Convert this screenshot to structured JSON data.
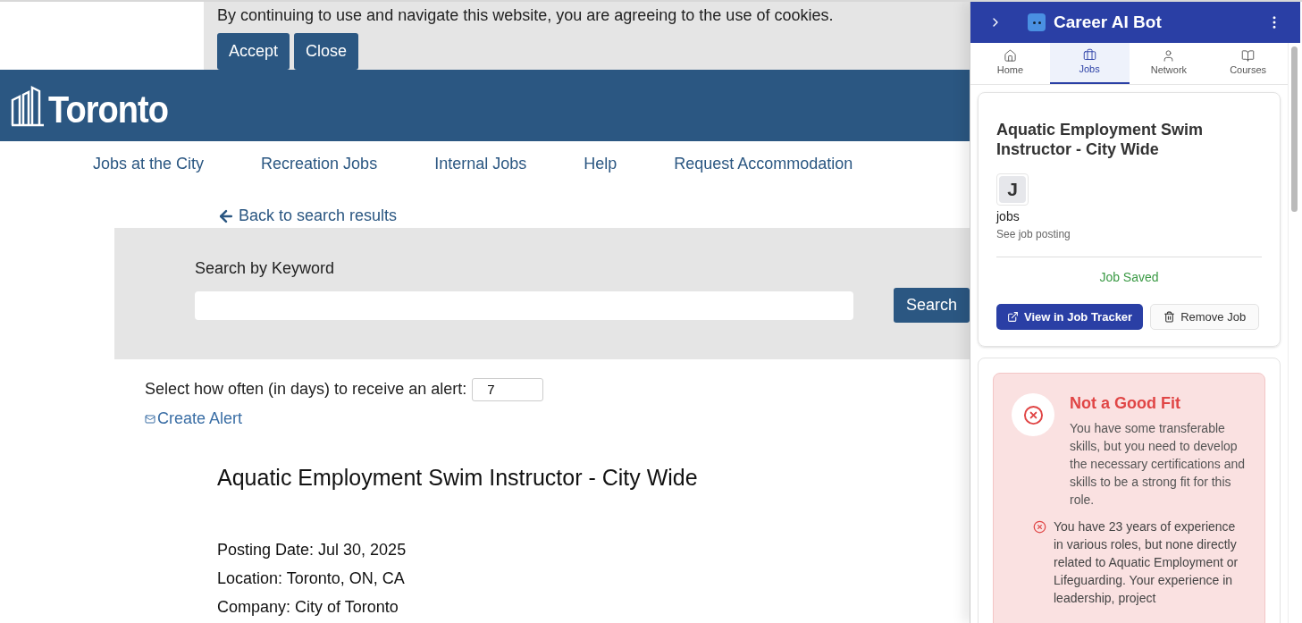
{
  "cookie_banner": {
    "message": "By continuing to use and navigate this website, you are agreeing to the use of cookies.",
    "buttons": [
      "Accept",
      "Close"
    ]
  },
  "header": {
    "logo": "Toronto"
  },
  "nav": [
    "Jobs at the City",
    "Recreation Jobs",
    "Internal Jobs",
    "Help",
    "Request Accommodation"
  ],
  "back_link": "Back to search results",
  "search": {
    "label": "Search by Keyword",
    "button": "Search"
  },
  "alert": {
    "label": "Select how often (in days) to receive an alert:",
    "value": "7",
    "link": "Create Alert"
  },
  "job": {
    "title": "Aquatic Employment Swim Instructor - City Wide",
    "details": [
      "Posting Date: Jul 30, 2025",
      "Location: Toronto, ON, CA",
      "Company: City of Toronto"
    ]
  },
  "panel": {
    "title": "Career AI Bot",
    "tabs": [
      {
        "label": "Home",
        "selected": false
      },
      {
        "label": "Jobs",
        "selected": true
      },
      {
        "label": "Network",
        "selected": false
      },
      {
        "label": "Courses",
        "selected": false
      }
    ],
    "job_card": {
      "title": "Aquatic Employment Swim Instructor - City Wide",
      "avatar": "J",
      "company": "jobs",
      "link": "See job posting",
      "status": "Job Saved",
      "buttons": [
        {
          "kind": "primary",
          "label": "View in Job Tracker"
        },
        {
          "kind": "secondary",
          "label": "Remove Job"
        }
      ]
    },
    "fit": {
      "heading": "Not a Good Fit",
      "summary": "You have some transferable skills, but you need to develop the necessary certifications and skills to be a strong fit for this role.",
      "reasons": [
        "You have 23 years of experience in various roles, but none directly related to Aquatic Employment or Lifeguarding. Your experience in leadership, project"
      ]
    }
  }
}
